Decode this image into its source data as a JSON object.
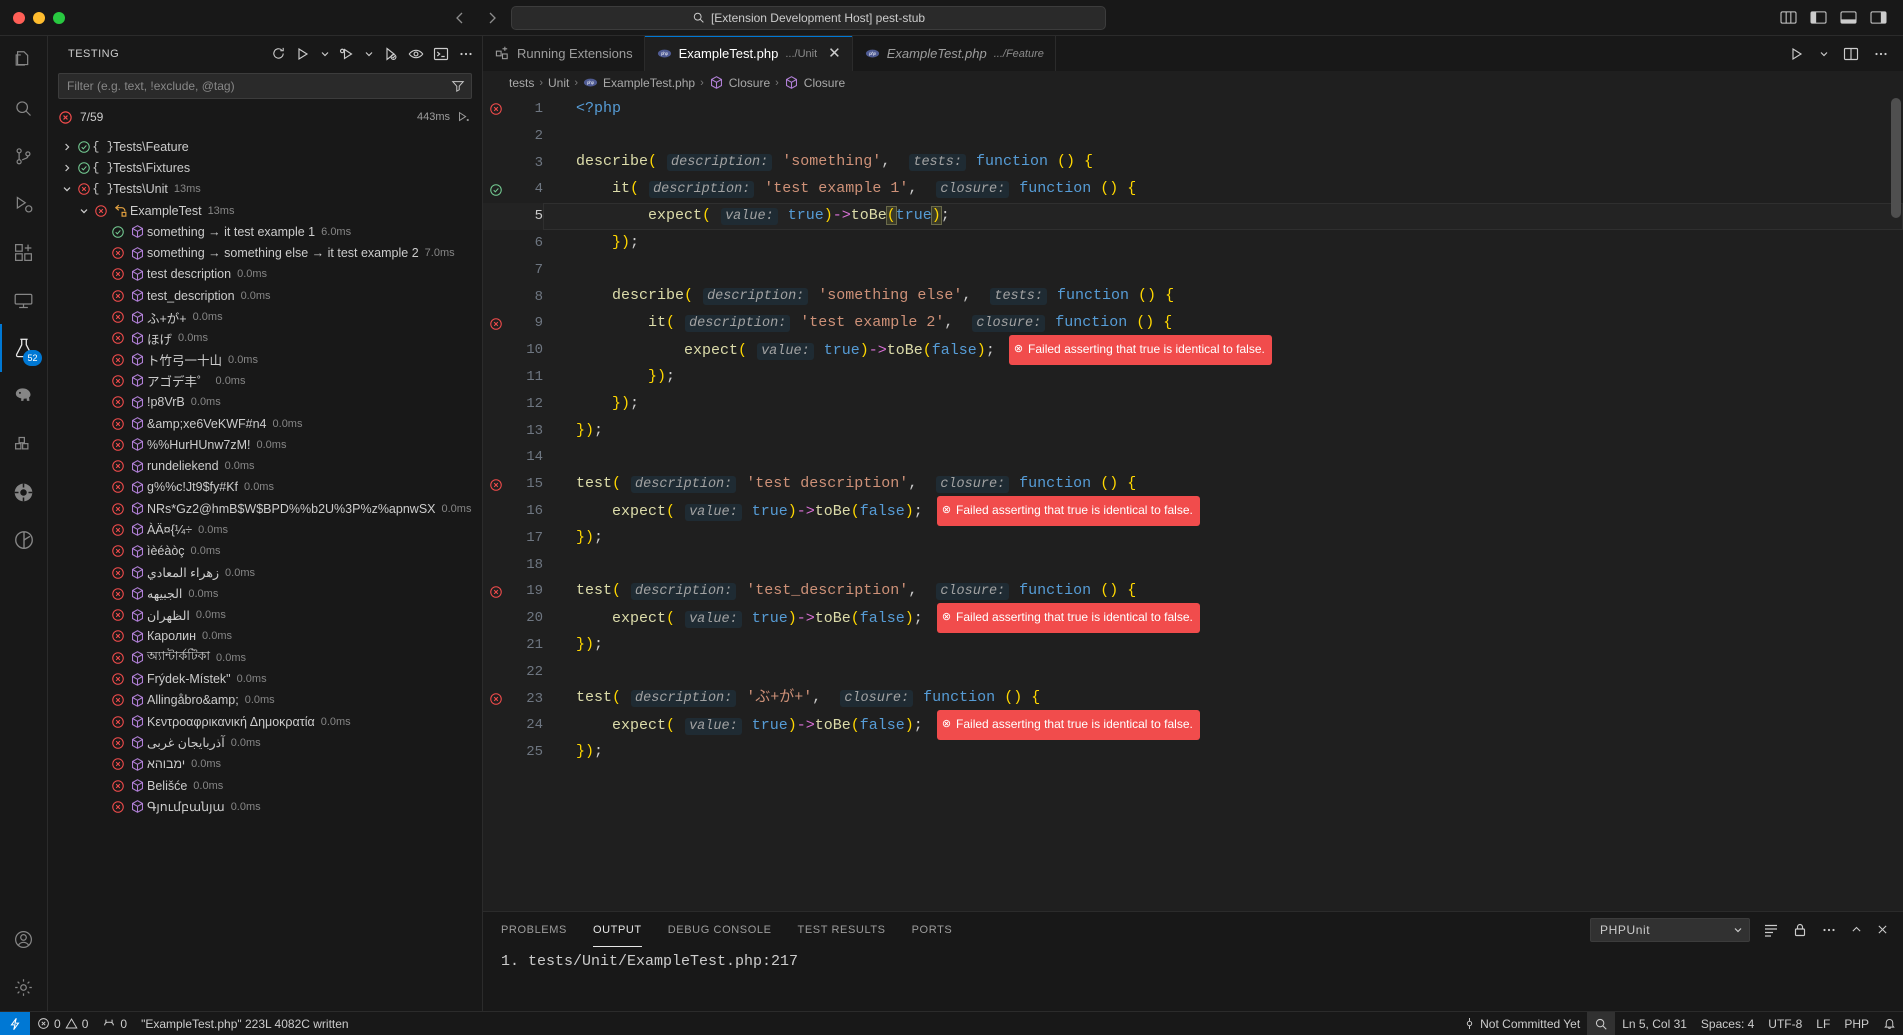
{
  "titlebar": {
    "quick_input": "[Extension Development Host] pest-stub",
    "search_icon": "search-icon"
  },
  "activitybar": {
    "items": [
      {
        "name": "explorer",
        "icon": "files-icon"
      },
      {
        "name": "search",
        "icon": "search-icon"
      },
      {
        "name": "source-control",
        "icon": "source-control-icon"
      },
      {
        "name": "run-debug",
        "icon": "run-debug-icon"
      },
      {
        "name": "extensions",
        "icon": "extensions-icon"
      },
      {
        "name": "remote-explorer",
        "icon": "remote-explorer-icon"
      },
      {
        "name": "testing",
        "icon": "beaker-icon",
        "badge": "52",
        "active": true
      },
      {
        "name": "php-tools",
        "icon": "elephant-icon"
      },
      {
        "name": "containers",
        "icon": "containers-icon"
      },
      {
        "name": "database",
        "icon": "database-icon"
      },
      {
        "name": "gitlens",
        "icon": "gitlens-icon"
      }
    ],
    "bottom": [
      {
        "name": "accounts",
        "icon": "account-icon"
      },
      {
        "name": "settings",
        "icon": "gear-icon"
      }
    ]
  },
  "sidebar": {
    "title": "TESTING",
    "actions": [
      {
        "name": "refresh-tests",
        "icon": "refresh-icon"
      },
      {
        "name": "run-all-tests",
        "icon": "run-icon"
      },
      {
        "name": "run-all-tests-dropdown",
        "icon": "chevron-down-icon"
      },
      {
        "name": "debug-all-tests",
        "icon": "debug-icon"
      },
      {
        "name": "debug-all-tests-dropdown",
        "icon": "chevron-down-icon"
      },
      {
        "name": "run-tests-with-coverage",
        "icon": "coverage-icon"
      },
      {
        "name": "show-output",
        "icon": "eye-icon"
      },
      {
        "name": "open-terminal",
        "icon": "terminal-icon"
      },
      {
        "name": "more-actions",
        "icon": "ellipsis-icon"
      }
    ],
    "filter_placeholder": "Filter (e.g. text, !exclude, @tag)",
    "filter_value": "",
    "filter_icon": "funnel-icon",
    "summary": {
      "status_icon": "error-icon",
      "counts": "7/59",
      "duration": "443ms",
      "trend_icon": "run-continuous-icon"
    },
    "tree": [
      {
        "indent": 0,
        "twist": "collapsed",
        "state": "passed",
        "kind": "namespace",
        "label": "Tests\\Feature",
        "duration": ""
      },
      {
        "indent": 0,
        "twist": "collapsed",
        "state": "passed",
        "kind": "namespace",
        "label": "Tests\\Fixtures",
        "duration": ""
      },
      {
        "indent": 0,
        "twist": "expanded",
        "state": "failed",
        "kind": "namespace",
        "label": "Tests\\Unit",
        "duration": "13ms"
      },
      {
        "indent": 1,
        "twist": "expanded",
        "state": "failed",
        "kind": "class",
        "label": "ExampleTest",
        "duration": "13ms"
      },
      {
        "indent": 2,
        "twist": "none",
        "state": "passed",
        "kind": "test",
        "label": "something → it test example 1",
        "duration": "6.0ms"
      },
      {
        "indent": 2,
        "twist": "none",
        "state": "failed",
        "kind": "test",
        "label": "something → something else → it test example 2",
        "duration": "7.0ms"
      },
      {
        "indent": 2,
        "twist": "none",
        "state": "failed",
        "kind": "test",
        "label": "test description",
        "duration": "0.0ms"
      },
      {
        "indent": 2,
        "twist": "none",
        "state": "failed",
        "kind": "test",
        "label": "test_description",
        "duration": "0.0ms"
      },
      {
        "indent": 2,
        "twist": "none",
        "state": "failed",
        "kind": "test",
        "label": "ふ+が+",
        "duration": "0.0ms"
      },
      {
        "indent": 2,
        "twist": "none",
        "state": "failed",
        "kind": "test",
        "label": "ほげ",
        "duration": "0.0ms"
      },
      {
        "indent": 2,
        "twist": "none",
        "state": "failed",
        "kind": "test",
        "label": "ト竹弓一十山",
        "duration": "0.0ms"
      },
      {
        "indent": 2,
        "twist": "none",
        "state": "failed",
        "kind": "test",
        "label": "アゴデ丰゜",
        "duration": "0.0ms"
      },
      {
        "indent": 2,
        "twist": "none",
        "state": "failed",
        "kind": "test",
        "label": "!p8VrB",
        "duration": "0.0ms"
      },
      {
        "indent": 2,
        "twist": "none",
        "state": "failed",
        "kind": "test",
        "label": "&amp;xe6VeKWF#n4",
        "duration": "0.0ms"
      },
      {
        "indent": 2,
        "twist": "none",
        "state": "failed",
        "kind": "test",
        "label": "%%HurHUnw7zM!",
        "duration": "0.0ms"
      },
      {
        "indent": 2,
        "twist": "none",
        "state": "failed",
        "kind": "test",
        "label": "rundeliekend",
        "duration": "0.0ms"
      },
      {
        "indent": 2,
        "twist": "none",
        "state": "failed",
        "kind": "test",
        "label": "g%%c!Jt9$fy#Kf",
        "duration": "0.0ms"
      },
      {
        "indent": 2,
        "twist": "none",
        "state": "failed",
        "kind": "test",
        "label": "NRs*Gz2@hmB$W$BPD%%b2U%3P%z%apnwSX",
        "duration": "0.0ms"
      },
      {
        "indent": 2,
        "twist": "none",
        "state": "failed",
        "kind": "test",
        "label": "ÀÄ¤{¼÷",
        "duration": "0.0ms"
      },
      {
        "indent": 2,
        "twist": "none",
        "state": "failed",
        "kind": "test",
        "label": "ìèéàòç",
        "duration": "0.0ms"
      },
      {
        "indent": 2,
        "twist": "none",
        "state": "failed",
        "kind": "test",
        "label": "زهراء المعادي",
        "duration": "0.0ms"
      },
      {
        "indent": 2,
        "twist": "none",
        "state": "failed",
        "kind": "test",
        "label": "الجبيهه",
        "duration": "0.0ms"
      },
      {
        "indent": 2,
        "twist": "none",
        "state": "failed",
        "kind": "test",
        "label": "الظهران",
        "duration": "0.0ms"
      },
      {
        "indent": 2,
        "twist": "none",
        "state": "failed",
        "kind": "test",
        "label": "Каролин",
        "duration": "0.0ms"
      },
      {
        "indent": 2,
        "twist": "none",
        "state": "failed",
        "kind": "test",
        "label": "অ্যান্টার্কটিকা",
        "duration": "0.0ms"
      },
      {
        "indent": 2,
        "twist": "none",
        "state": "failed",
        "kind": "test",
        "label": "Frýdek-Místek\"",
        "duration": "0.0ms"
      },
      {
        "indent": 2,
        "twist": "none",
        "state": "failed",
        "kind": "test",
        "label": "Allingåbro&amp;",
        "duration": "0.0ms"
      },
      {
        "indent": 2,
        "twist": "none",
        "state": "failed",
        "kind": "test",
        "label": "Κεντροαφρικανική Δημοκρατία",
        "duration": "0.0ms"
      },
      {
        "indent": 2,
        "twist": "none",
        "state": "failed",
        "kind": "test",
        "label": "آذربایجان غربی",
        "duration": "0.0ms"
      },
      {
        "indent": 2,
        "twist": "none",
        "state": "failed",
        "kind": "test",
        "label": "ימבוהא",
        "duration": "0.0ms"
      },
      {
        "indent": 2,
        "twist": "none",
        "state": "failed",
        "kind": "test",
        "label": "Belišće",
        "duration": "0.0ms"
      },
      {
        "indent": 2,
        "twist": "none",
        "state": "failed",
        "kind": "test",
        "label": "Գյումբանյա",
        "duration": "0.0ms"
      }
    ]
  },
  "editor": {
    "tabs": [
      {
        "name": "running-extensions",
        "label": "Running Extensions",
        "sub": "",
        "icon": "extensions-icon",
        "active": false,
        "preview": false,
        "closable": false
      },
      {
        "name": "example-test-unit",
        "label": "ExampleTest.php",
        "sub": ".../Unit",
        "icon": "php-icon",
        "active": true,
        "preview": false,
        "closable": true
      },
      {
        "name": "example-test-feature",
        "label": "ExampleTest.php",
        "sub": ".../Feature",
        "icon": "php-icon",
        "active": false,
        "preview": true,
        "closable": false
      }
    ],
    "tab_actions": [
      {
        "name": "run-or-debug",
        "icon": "run-icon"
      },
      {
        "name": "run-or-debug-dropdown",
        "icon": "chevron-down-icon"
      },
      {
        "name": "split-editor",
        "icon": "split-editor-icon"
      },
      {
        "name": "more-actions",
        "icon": "ellipsis-icon"
      }
    ],
    "breadcrumbs": [
      "tests",
      "Unit",
      "ExampleTest.php",
      "Closure",
      "Closure"
    ],
    "breadcrumb_icons": [
      "",
      "",
      "php-icon",
      "symbol-icon",
      "symbol-icon"
    ],
    "error_message": "Failed asserting that true is identical to false.",
    "lines": [
      {
        "n": 1,
        "state": "failed"
      },
      {
        "n": 2,
        "state": ""
      },
      {
        "n": 3,
        "state": ""
      },
      {
        "n": 4,
        "state": "passed"
      },
      {
        "n": 5,
        "state": "",
        "current": true
      },
      {
        "n": 6,
        "state": ""
      },
      {
        "n": 7,
        "state": ""
      },
      {
        "n": 8,
        "state": ""
      },
      {
        "n": 9,
        "state": "failed"
      },
      {
        "n": 10,
        "state": ""
      },
      {
        "n": 11,
        "state": ""
      },
      {
        "n": 12,
        "state": ""
      },
      {
        "n": 13,
        "state": ""
      },
      {
        "n": 14,
        "state": ""
      },
      {
        "n": 15,
        "state": "failed"
      },
      {
        "n": 16,
        "state": ""
      },
      {
        "n": 17,
        "state": ""
      },
      {
        "n": 18,
        "state": ""
      },
      {
        "n": 19,
        "state": "failed"
      },
      {
        "n": 20,
        "state": ""
      },
      {
        "n": 21,
        "state": ""
      },
      {
        "n": 22,
        "state": ""
      },
      {
        "n": 23,
        "state": "failed"
      },
      {
        "n": 24,
        "state": ""
      },
      {
        "n": 25,
        "state": ""
      }
    ],
    "source_text": [
      "<?php",
      "",
      "describe( description: 'something',  tests: function () {",
      "    it( description: 'test example 1',  closure: function () {",
      "        expect( value: true)->toBe(true);",
      "    });",
      "",
      "    describe( description: 'something else',  tests: function () {",
      "        it( description: 'test example 2',  closure: function () {",
      "            expect( value: true)->toBe(false);",
      "        });",
      "    });",
      "});",
      "",
      "test( description: 'test description',  closure: function () {",
      "    expect( value: true)->toBe(false);",
      "});",
      "",
      "test( description: 'test_description',  closure: function () {",
      "    expect( value: true)->toBe(false);",
      "});",
      "",
      "test( description: 'ふ+が+',  closure: function () {",
      "    expect( value: true)->toBe(false);",
      "});"
    ]
  },
  "panel": {
    "tabs": [
      {
        "name": "problems",
        "label": "PROBLEMS",
        "active": false
      },
      {
        "name": "output",
        "label": "OUTPUT",
        "active": true
      },
      {
        "name": "debug-console",
        "label": "DEBUG CONSOLE",
        "active": false
      },
      {
        "name": "test-results",
        "label": "TEST RESULTS",
        "active": false
      },
      {
        "name": "ports",
        "label": "PORTS",
        "active": false
      }
    ],
    "channel": "PHPUnit",
    "actions": [
      {
        "name": "clear-output",
        "icon": "clear-icon"
      },
      {
        "name": "toggle-lock",
        "icon": "lock-icon"
      },
      {
        "name": "more-actions",
        "icon": "ellipsis-icon"
      },
      {
        "name": "maximize-panel",
        "icon": "chevron-up-icon"
      },
      {
        "name": "close-panel",
        "icon": "close-icon"
      }
    ],
    "content": "1. tests/Unit/ExampleTest.php:217"
  },
  "statusbar": {
    "remote_icon": "remote-icon",
    "errors": "0",
    "warnings": "0",
    "ports": "0",
    "message": "\"ExampleTest.php\" 223L 4082C written",
    "git_blame": "Not Committed Yet",
    "cursor": "Ln 5, Col 31",
    "indent": "Spaces: 4",
    "encoding": "UTF-8",
    "eol": "LF",
    "language": "PHP",
    "bell_icon": "bell-icon",
    "magnify_icon": "magnify-icon"
  },
  "colors": {
    "accent": "#0078d4",
    "error": "#f14c4c",
    "pass": "#73c991",
    "bg": "#1f1f1f",
    "panel_bg": "#181818"
  }
}
